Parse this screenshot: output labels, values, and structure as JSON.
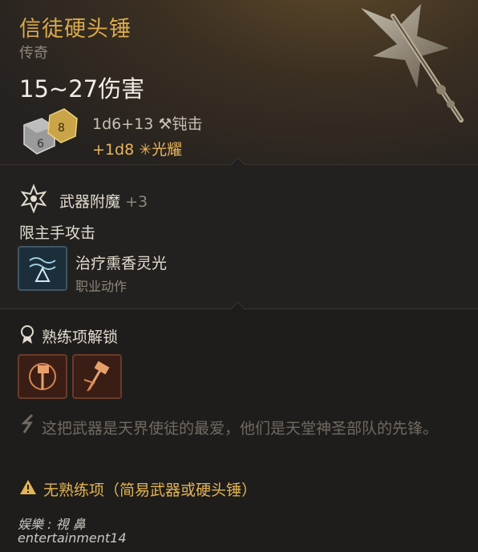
{
  "item": {
    "name": "信徒硬头锤",
    "rarity": "传奇",
    "damage_range": "15~27伤害",
    "damage_base": "1d6+13",
    "damage_base_type": "钝击",
    "damage_bonus": "+1d8",
    "damage_bonus_type": "光耀",
    "dice_number": "8"
  },
  "enchant": {
    "label": "武器附魔",
    "value": "+3",
    "restriction": "限主手攻击",
    "action_name": "治疗熏香灵光",
    "action_type": "职业动作"
  },
  "proficiency": {
    "label": "熟练项解锁"
  },
  "flavor_text": "这把武器是天界使徒的最爱，他们是天堂神圣部队的先锋。",
  "warning": "无熟练项（简易武器或硬头锤）",
  "watermark": {
    "line1": "娱樂 :  視 鼻",
    "line2": "entertainment14"
  },
  "colors": {
    "title": "#d9a94c",
    "radiant": "#e8b657",
    "warning": "#e2b453",
    "text": "#e2dccf",
    "muted": "#8d8678"
  },
  "icons": [
    "weapon-image-icon",
    "dice-icon",
    "hammer-icon",
    "radiant-icon",
    "enchant-icon",
    "healing-incense-icon",
    "proficiency-icon",
    "proficiency-action-icon",
    "flavor-quill-icon",
    "warning-icon"
  ]
}
